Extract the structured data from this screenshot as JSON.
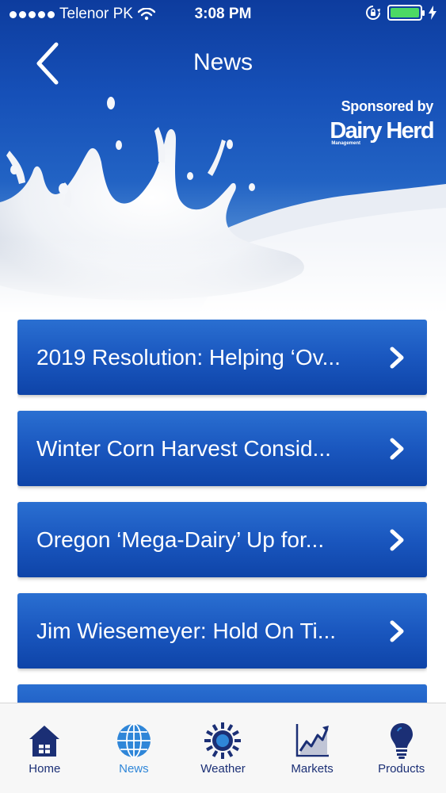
{
  "status_bar": {
    "carrier": "Telenor PK",
    "time": "3:08 PM"
  },
  "nav": {
    "title": "News",
    "back_icon": "chevron-left-icon"
  },
  "sponsor": {
    "label": "Sponsored by",
    "logo_text": "Dairy Herd",
    "logo_subtext": "Management"
  },
  "news": {
    "items": [
      {
        "title": "2019 Resolution: Helping ‘Ov...",
        "icon": "chevron-right-icon"
      },
      {
        "title": "Winter Corn Harvest Consid...",
        "icon": "chevron-right-icon"
      },
      {
        "title": "Oregon ‘Mega-Dairy’ Up for...",
        "icon": "chevron-right-icon"
      },
      {
        "title": "Jim Wiesemeyer: Hold On Ti...",
        "icon": "chevron-right-icon"
      },
      {
        "title": "",
        "icon": "chevron-right-icon"
      }
    ]
  },
  "tabs": [
    {
      "label": "Home",
      "icon": "home-icon",
      "active": false
    },
    {
      "label": "News",
      "icon": "globe-icon",
      "active": true
    },
    {
      "label": "Weather",
      "icon": "sun-icon",
      "active": false
    },
    {
      "label": "Markets",
      "icon": "chart-icon",
      "active": false
    },
    {
      "label": "Products",
      "icon": "lightbulb-icon",
      "active": false
    }
  ],
  "colors": {
    "header_blue": "#1650b8",
    "button_blue": "#1a57bf",
    "tab_active": "#2f86d8",
    "tab_inactive": "#1b2f75",
    "battery_green": "#4cd964"
  }
}
